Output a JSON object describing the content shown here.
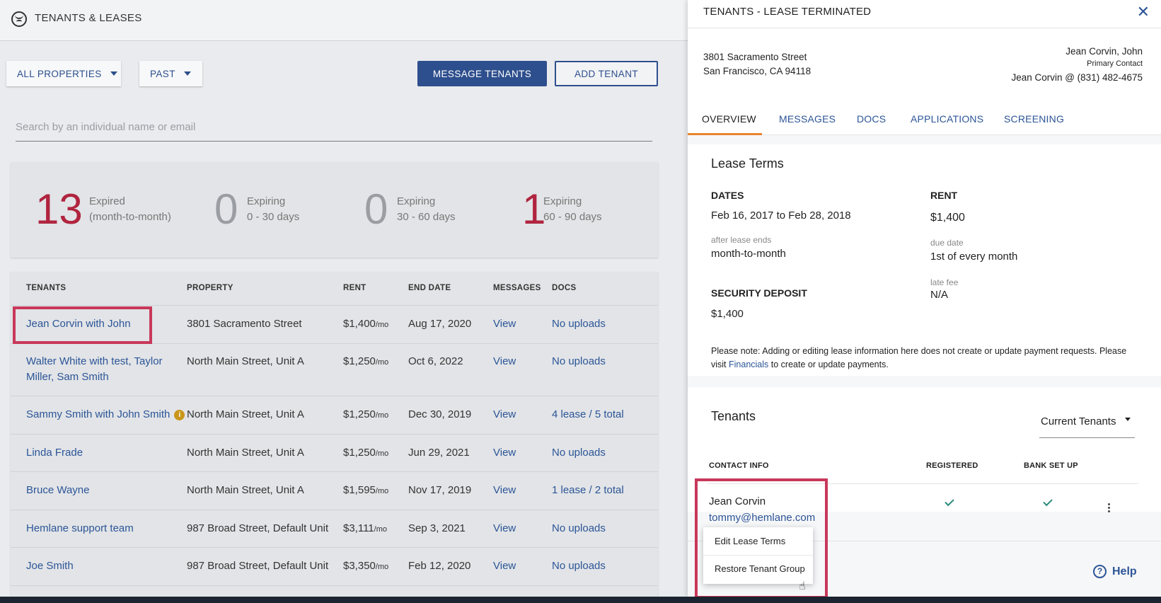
{
  "app": {
    "title": "TENANTS & LEASES"
  },
  "filters": {
    "properties": "ALL PROPERTIES",
    "status": "PAST"
  },
  "actions": {
    "message_tenants": "MESSAGE TENANTS",
    "add_tenant": "ADD TENANT"
  },
  "search": {
    "placeholder": "Search by an individual name or email",
    "value": ""
  },
  "stats": [
    {
      "count": "13",
      "line1": "Expired",
      "line2": "(month-to-month)"
    },
    {
      "count": "0",
      "line1": "Expiring",
      "line2": "0 - 30 days"
    },
    {
      "count": "0",
      "line1": "Expiring",
      "line2": "30 - 60 days"
    },
    {
      "count": "1",
      "line1": "Expiring",
      "line2": "60 - 90 days"
    }
  ],
  "table": {
    "columns": [
      "TENANTS",
      "PROPERTY",
      "RENT",
      "END DATE",
      "MESSAGES",
      "DOCS"
    ],
    "rent_suffix": "/mo",
    "rows": [
      {
        "tenant": "Jean Corvin with John",
        "property": "3801 Sacramento Street",
        "rent": "$1,400",
        "end_date": "Aug 17, 2020",
        "messages": "View",
        "docs": "No uploads"
      },
      {
        "tenant": "Walter White with test, Taylor Miller, Sam Smith",
        "property": "North Main Street, Unit A",
        "rent": "$1,250",
        "end_date": "Oct 6, 2022",
        "messages": "View",
        "docs": "No uploads"
      },
      {
        "tenant": "Sammy Smith with John Smith",
        "property": "North Main Street, Unit A",
        "rent": "$1,250",
        "end_date": "Dec 30, 2019",
        "messages": "View",
        "docs": "4 lease / 5 total"
      },
      {
        "tenant": "Linda Frade",
        "property": "North Main Street, Unit A",
        "rent": "$1,250",
        "end_date": "Jun 29, 2021",
        "messages": "View",
        "docs": "No uploads"
      },
      {
        "tenant": "Bruce Wayne",
        "property": "North Main Street, Unit A",
        "rent": "$1,595",
        "end_date": "Nov 17, 2019",
        "messages": "View",
        "docs": "1 lease / 2 total"
      },
      {
        "tenant": "Hemlane support team",
        "property": "987 Broad Street, Default Unit",
        "rent": "$3,111",
        "end_date": "Sep 3, 2021",
        "messages": "View",
        "docs": "No uploads"
      },
      {
        "tenant": "Joe Smith",
        "property": "987 Broad Street, Default Unit",
        "rent": "$3,350",
        "end_date": "Feb 12, 2020",
        "messages": "View",
        "docs": "No uploads"
      }
    ]
  },
  "panel": {
    "title": "TENANTS - LEASE TERMINATED",
    "address": {
      "line1": "3801 Sacramento Street",
      "line2": "San Francisco, CA 94118"
    },
    "contact": {
      "name": "Jean Corvin, John",
      "role": "Primary Contact",
      "detail": "Jean Corvin @ (831) 482-4675"
    },
    "tabs": [
      "OVERVIEW",
      "MESSAGES",
      "DOCS",
      "APPLICATIONS",
      "SCREENING"
    ],
    "lease_terms": {
      "heading": "Lease Terms",
      "dates_label": "DATES",
      "dates_value": "Feb 16, 2017 to Feb 28, 2018",
      "after_label": "after lease ends",
      "after_value": "month-to-month",
      "rent_label": "RENT",
      "rent_value": "$1,400",
      "due_label": "due date",
      "due_value": "1st of every month",
      "late_label": "late fee",
      "late_value": "N/A",
      "deposit_label": "SECURITY DEPOSIT",
      "deposit_value": "$1,400",
      "note_before": "Please note: Adding or editing lease information here does not create or update payment requests. Please visit ",
      "note_link": "Financials",
      "note_after": " to create or update payments."
    },
    "tenants": {
      "heading": "Tenants",
      "filter": "Current Tenants",
      "columns": [
        "CONTACT INFO",
        "REGISTERED",
        "BANK SET UP"
      ],
      "row": {
        "name": "Jean Corvin",
        "email": "tommy@hemlane.com",
        "registered": true,
        "bank_set_up": true
      }
    },
    "menu": [
      "Edit Lease Terms",
      "Restore Tenant Group"
    ],
    "help": "Help"
  }
}
